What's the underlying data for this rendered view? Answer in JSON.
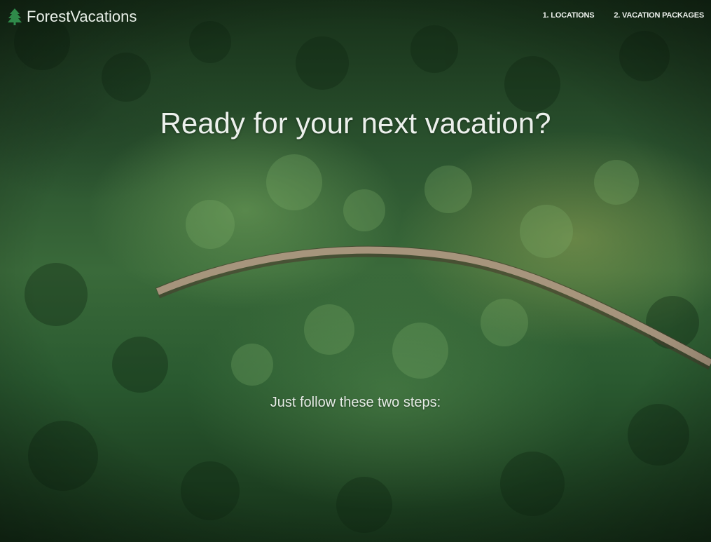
{
  "brand": {
    "name": "ForestVacations",
    "icon": "tree-icon"
  },
  "nav": {
    "links": [
      {
        "label": "1. LOCATIONS"
      },
      {
        "label": "2. VACATION PACKAGES"
      }
    ]
  },
  "hero": {
    "headline": "Ready for your next vacation?",
    "subhead": "Just follow these two steps:",
    "image": "aerial-forest-road"
  },
  "colors": {
    "text": "#ecf0ec",
    "forest_dark": "#173019",
    "forest_mid": "#3a6a3a",
    "road": "#b7a18a"
  }
}
